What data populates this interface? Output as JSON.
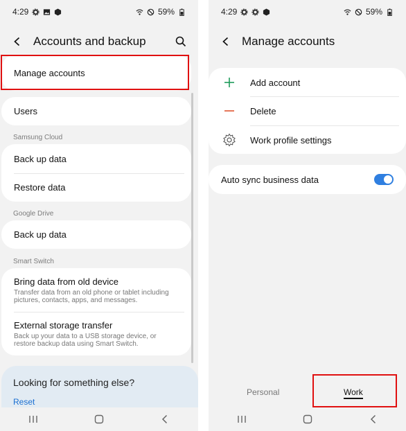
{
  "left": {
    "status": {
      "time": "4:29",
      "battery": "59%"
    },
    "header": {
      "title": "Accounts and backup"
    },
    "rows": {
      "manage_accounts": "Manage accounts",
      "users": "Users"
    },
    "sections": {
      "samsung_cloud": "Samsung Cloud",
      "google_drive": "Google Drive",
      "smart_switch": "Smart Switch"
    },
    "samsung_cloud": {
      "back_up": "Back up data",
      "restore": "Restore data"
    },
    "google_drive": {
      "back_up": "Back up data"
    },
    "smart_switch": {
      "bring_title": "Bring data from old device",
      "bring_sub": "Transfer data from an old phone or tablet including pictures, contacts, apps, and messages.",
      "external_title": "External storage transfer",
      "external_sub": "Back up your data to a USB storage device, or restore backup data using Smart Switch."
    },
    "suggest": {
      "question": "Looking for something else?",
      "reset": "Reset"
    }
  },
  "right": {
    "status": {
      "time": "4:29",
      "battery": "59%"
    },
    "header": {
      "title": "Manage accounts"
    },
    "items": {
      "add_account": "Add account",
      "delete": "Delete",
      "work_profile": "Work profile settings"
    },
    "auto_sync": {
      "label": "Auto sync business data",
      "enabled": true
    },
    "tabs": {
      "personal": "Personal",
      "work": "Work",
      "selected": "Work"
    }
  },
  "colors": {
    "highlight": "#e01010",
    "accent_blue": "#2f7fe0",
    "add_green": "#1e9b5a",
    "delete_red": "#e0552f",
    "link_blue": "#1a6fd1"
  }
}
